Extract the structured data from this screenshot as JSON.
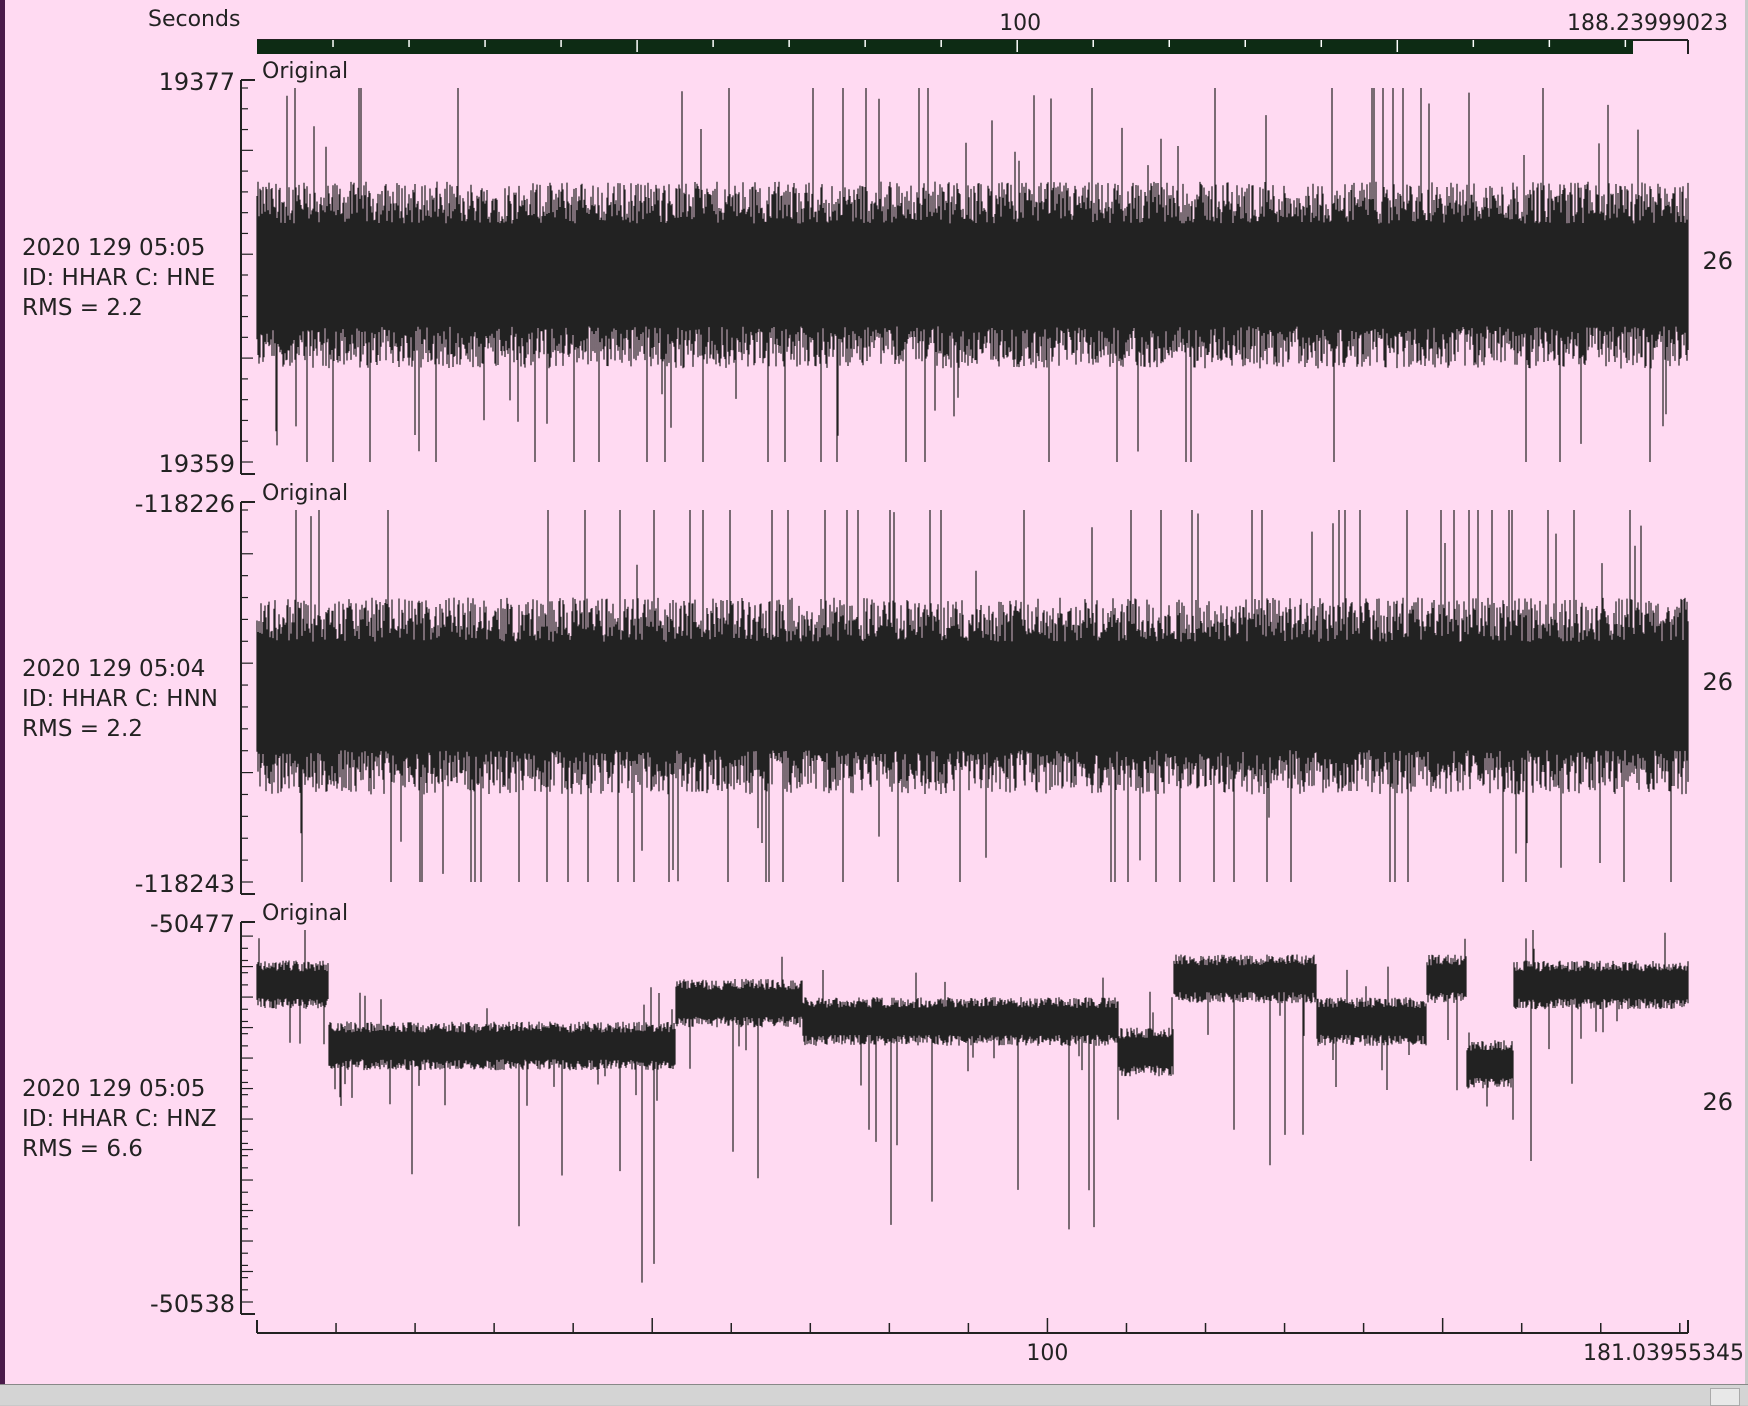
{
  "chart_data": {
    "type": "line",
    "time_axis_top": {
      "label": "Seconds",
      "mid_tick": "100",
      "end_value": "188.23999023",
      "mid_value": 100,
      "max_value": 188.23999023
    },
    "time_axis_bottom": {
      "mid_tick": "100",
      "end_value": "181.03955345",
      "mid_value": 100,
      "max_value": 181.03955345
    },
    "traces": [
      {
        "name": "HNE",
        "filter_label": "Original",
        "ymax": 19377,
        "ymin": 19359,
        "ymax_label": "19377",
        "ymin_label": "19359",
        "date_label": "2020 129 05:05",
        "id_label": "ID: HHAR C: HNE",
        "rms_label": "RMS = 2.2",
        "right_label": "26",
        "style": "noise",
        "center": 19368,
        "band_halfwidth": 4.5
      },
      {
        "name": "HNN",
        "filter_label": "Original",
        "ymax": -118226,
        "ymin": -118243,
        "ymax_label": "-118226",
        "ymin_label": "-118243",
        "date_label": "2020 129 05:04",
        "id_label": "ID: HHAR C: HNN",
        "rms_label": "RMS = 2.2",
        "right_label": "26",
        "style": "noise",
        "center": -118234.5,
        "band_halfwidth": 4.5
      },
      {
        "name": "HNZ",
        "filter_label": "Original",
        "ymax": -50477,
        "ymin": -50538,
        "ymax_label": "-50477",
        "ymin_label": "-50538",
        "date_label": "2020 129 05:05",
        "id_label": "ID: HHAR C: HNZ",
        "rms_label": "RMS = 6.6",
        "right_label": "26",
        "style": "steps",
        "segments": [
          {
            "t0": 0,
            "t1": 9,
            "level": -50486
          },
          {
            "t0": 9,
            "t1": 53,
            "level": -50496
          },
          {
            "t0": 53,
            "t1": 69,
            "level": -50489
          },
          {
            "t0": 69,
            "t1": 109,
            "level": -50492
          },
          {
            "t0": 109,
            "t1": 116,
            "level": -50497
          },
          {
            "t0": 116,
            "t1": 134,
            "level": -50485
          },
          {
            "t0": 134,
            "t1": 148,
            "level": -50492
          },
          {
            "t0": 148,
            "t1": 153,
            "level": -50485
          },
          {
            "t0": 153,
            "t1": 159,
            "level": -50499
          },
          {
            "t0": 159,
            "t1": 181,
            "level": -50486
          }
        ]
      }
    ],
    "colors": {
      "background": "#ffdaf2",
      "trace": "#222222",
      "scrollbar": "#0d2b14"
    }
  }
}
